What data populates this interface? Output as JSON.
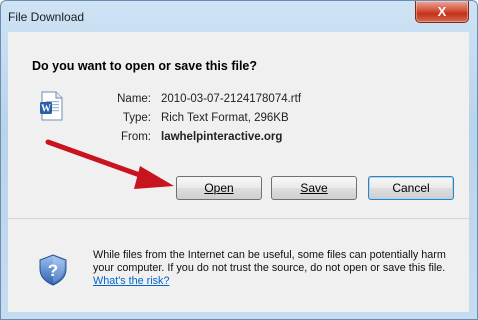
{
  "window": {
    "title": "File Download",
    "close_label": "X"
  },
  "dialog": {
    "question": "Do you want to open or save this file?",
    "fields": [
      {
        "label": "Name:",
        "value": "2010-03-07-2124178074.rtf"
      },
      {
        "label": "Type:",
        "value": "Rich Text Format, 296KB"
      },
      {
        "label": "From:",
        "value": "lawhelpinteractive.org"
      }
    ],
    "buttons": {
      "open": "Open",
      "save": "Save",
      "cancel": "Cancel"
    },
    "warning_text": "While files from the Internet can be useful, some files can potentially harm your computer. If you do not trust the source, do not open or save this file.",
    "risk_link": "What's the risk?"
  },
  "icons": {
    "file": "word-document-icon",
    "shield": "security-shield-question-icon",
    "annotation": "red-arrow"
  },
  "colors": {
    "arrow": "#c8141e",
    "link": "#0066cc",
    "close_button": "#c4311a",
    "default_button_border": "#3c7fb1"
  }
}
